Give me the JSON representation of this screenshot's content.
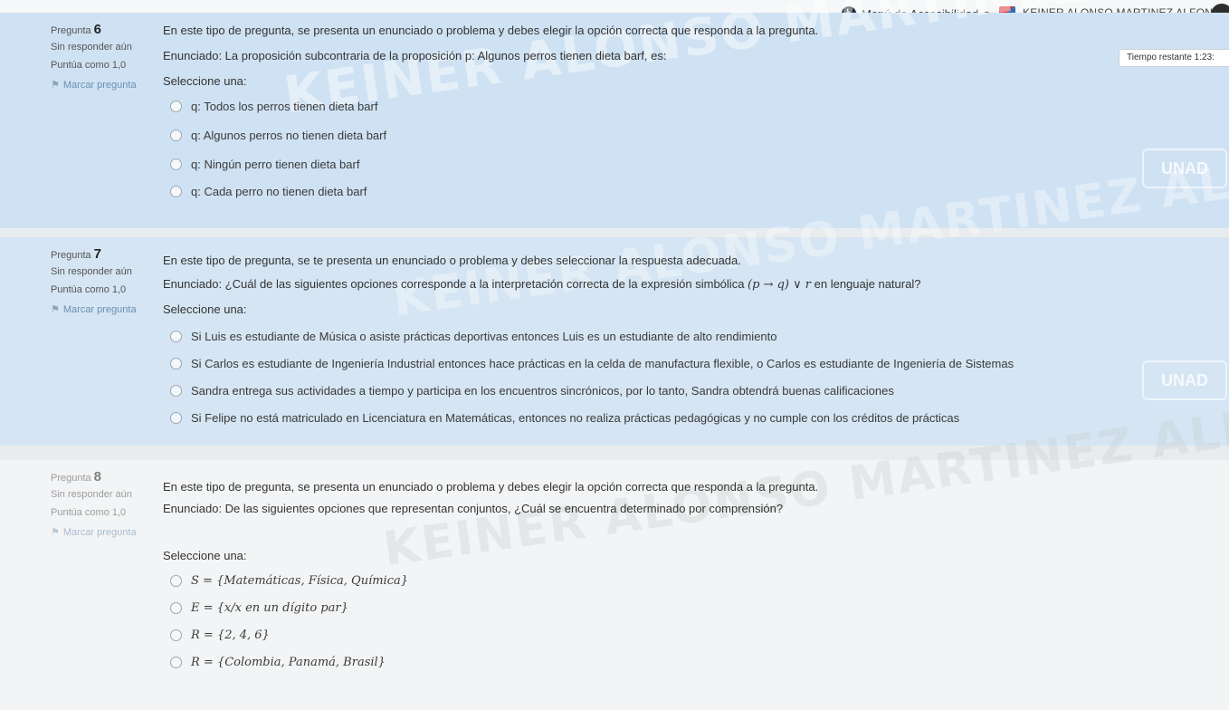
{
  "topbar": {
    "accessibility_label": "Menú de Accesibilidad",
    "user_name": "KEINER ALONSO MARTINEZ ALFONSO"
  },
  "timer": {
    "label": "Tiempo restante 1:23:"
  },
  "watermark": {
    "text": "KEINER ALONSO MARTINEZ ALFONSO"
  },
  "side_logo": {
    "text": "UNAD"
  },
  "questions": [
    {
      "label": "Pregunta",
      "number": "6",
      "state": "Sin responder aún",
      "mark": "Puntúa como 1,0",
      "flag": "Marcar pregunta",
      "intro": "En este tipo de pregunta, se presenta un enunciado o problema y debes elegir la opción correcta que responda a la pregunta.",
      "statement": "Enunciado: La proposición subcontraria de la proposición p: Algunos perros tienen dieta barf, es:",
      "prompt": "Seleccione una:",
      "options": [
        "q: Todos los perros tienen dieta barf",
        "q: Algunos perros no tienen dieta barf",
        "q: Ningún perro tienen dieta barf",
        "q: Cada perro no tienen dieta barf"
      ]
    },
    {
      "label": "Pregunta",
      "number": "7",
      "state": "Sin responder aún",
      "mark": "Puntúa como 1,0",
      "flag": "Marcar pregunta",
      "intro": "En este tipo de pregunta, se te presenta un enunciado o problema y debes seleccionar la respuesta adecuada.",
      "statement_pre": "Enunciado: ¿Cuál de las siguientes opciones corresponde a la interpretación correcta de la expresión simbólica",
      "statement_math": "(p → q) ∨ r",
      "statement_post": "en lenguaje natural?",
      "prompt": "Seleccione una:",
      "options": [
        "Si Luis es estudiante de Música o asiste prácticas deportivas entonces Luis es un estudiante de alto rendimiento",
        "Si Carlos es estudiante de Ingeniería Industrial entonces hace prácticas en la celda de manufactura flexible, o Carlos es estudiante de Ingeniería de Sistemas",
        "Sandra entrega sus actividades a tiempo y participa en los encuentros sincrónicos, por lo tanto, Sandra obtendrá buenas calificaciones",
        "Si Felipe no está matriculado en Licenciatura en Matemáticas, entonces no realiza prácticas pedagógicas y no cumple con los créditos de prácticas"
      ]
    },
    {
      "label": "Pregunta",
      "number": "8",
      "state": "Sin responder aún",
      "mark": "Puntúa como 1,0",
      "flag": "Marcar pregunta",
      "intro": "En este tipo de pregunta, se presenta un enunciado o problema y debes elegir la opción correcta que responda a la pregunta.",
      "statement": "Enunciado: De las siguientes opciones que representan conjuntos, ¿Cuál se encuentra determinado por comprensión?",
      "prompt": "Seleccione una:",
      "options": [
        "S = {Matemáticas, Física, Química}",
        "E = {x/x en un dígito par}",
        "R = {2, 4, 6}",
        "R = {Colombia, Panamá, Brasil}"
      ]
    }
  ]
}
